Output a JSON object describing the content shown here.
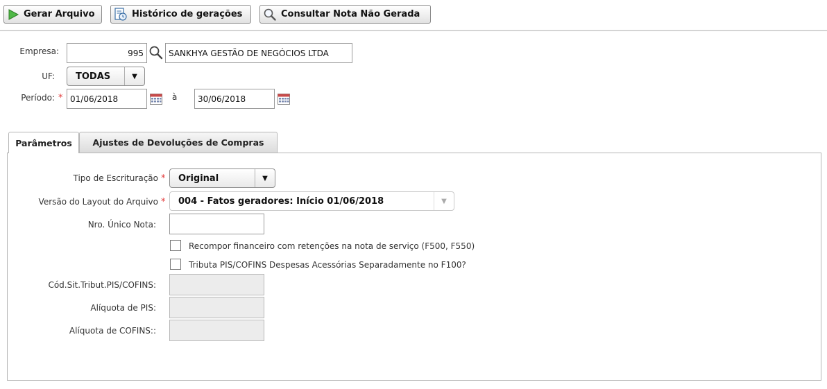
{
  "toolbar": {
    "generate_label": "Gerar Arquivo",
    "history_label": "Histórico de gerações",
    "query_label": "Consultar Nota Não Gerada"
  },
  "header_form": {
    "empresa_label": "Empresa:",
    "empresa_code": "995",
    "empresa_name": "SANKHYA GESTÃO DE NEGÓCIOS LTDA",
    "uf_label": "UF:",
    "uf_value": "TODAS",
    "periodo_label": "Período:",
    "periodo_start": "01/06/2018",
    "periodo_sep": "à",
    "periodo_end": "30/06/2018"
  },
  "tabs": [
    {
      "label": "Parâmetros",
      "active": true
    },
    {
      "label": "Ajustes de Devoluções de Compras",
      "active": false
    }
  ],
  "params": {
    "tipo_escrituracao_label": "Tipo de Escrituração",
    "tipo_escrituracao_value": "Original",
    "versao_layout_label": "Versão do Layout do Arquivo",
    "versao_layout_value": "004 - Fatos geradores: Início 01/06/2018",
    "nro_unico_label": "Nro. Único Nota:",
    "nro_unico_value": "",
    "recompor_label": "Recompor financeiro com retenções na nota de serviço (F500, F550)",
    "recompor_checked": false,
    "tributa_label": "Tributa PIS/COFINS Despesas Acessórias Separadamente no F100?",
    "tributa_checked": false,
    "cod_sit_label": "Cód.Sit.Tribut.PIS/COFINS:",
    "cod_sit_value": "",
    "aliq_pis_label": "Alíquota de PIS:",
    "aliq_pis_value": "",
    "aliq_cofins_label": "Alíquota de COFINS::",
    "aliq_cofins_value": ""
  },
  "required_mark": "*",
  "colors": {
    "required": "#e23b3b",
    "play_green": "#3fa535",
    "border": "#b5b5b5"
  }
}
